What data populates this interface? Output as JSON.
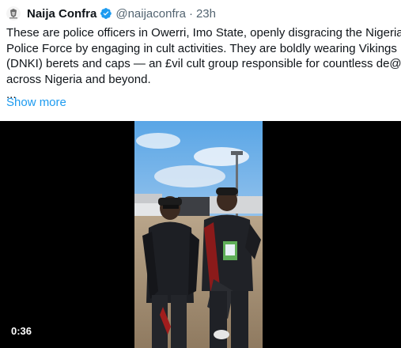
{
  "tweet": {
    "author": {
      "display_name": "Naija Confra",
      "handle": "@naijaconfra",
      "verified_icon": "verified-badge-icon",
      "avatar_icon": "coat-of-arms-avatar"
    },
    "separator": "·",
    "time": "23h",
    "text_lines": [
      "These are police officers in Owerri, Imo State, openly disgracing the Nigerian",
      "Police Force by engaging in cult activities. They are boldly wearing Vikings",
      "(DNKI) berets and caps — an £vil cult group responsible for countless de@ths",
      "across Nigeria and beyond.",
      "..."
    ],
    "show_more_label": "Show more",
    "video": {
      "duration": "0:36"
    }
  },
  "colors": {
    "text": "#0f1419",
    "secondary": "#536471",
    "link": "#1d9bf0",
    "verified": "#1d9bf0",
    "media_bg": "#000000"
  }
}
